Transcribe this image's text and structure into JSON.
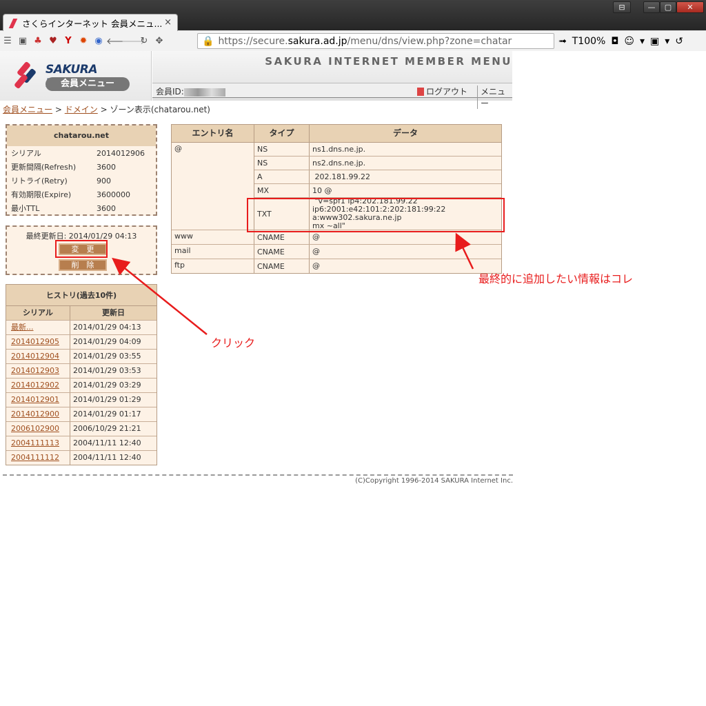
{
  "browser": {
    "tab_title": "さくらインターネット 会員メニュ...",
    "tab_close": "×",
    "url_scheme": "https://secure.",
    "url_host": "sakura.ad.jp",
    "url_path": "/menu/dns/view.php?zone=chatar",
    "zoom": "T100%",
    "window_buttons": [
      "⊟",
      "—",
      "▢",
      "✕"
    ]
  },
  "header": {
    "brand": "SAKURA Internet",
    "brand_sub": "会員メニュー",
    "title": "SAKURA INTERNET MEMBER MENU",
    "member_id_label": "会員ID:",
    "logout": "ログアウト",
    "menu": "メニュー"
  },
  "breadcrumb": {
    "item1": "会員メニュー",
    "sep": ">",
    "item2": "ドメイン",
    "current": "ゾーン表示(chatarou.net)"
  },
  "zone": {
    "name": "chatarou.net",
    "rows": [
      {
        "label": "シリアル",
        "value": "2014012906"
      },
      {
        "label": "更新間隔(Refresh)",
        "value": "3600"
      },
      {
        "label": "リトライ(Retry)",
        "value": "900"
      },
      {
        "label": "有効期限(Expire)",
        "value": "3600000"
      },
      {
        "label": "最小TTL",
        "value": "3600"
      }
    ]
  },
  "actions": {
    "last_updated": "最終更新日: 2014/01/29 04:13",
    "change_button": "変　更",
    "delete_button": "削　除"
  },
  "history": {
    "title": "ヒストリ(過去10件)",
    "col_serial": "シリアル",
    "col_date": "更新日",
    "rows": [
      {
        "serial": "最新...",
        "date": "2014/01/29 04:13"
      },
      {
        "serial": "2014012905",
        "date": "2014/01/29 04:09"
      },
      {
        "serial": "2014012904",
        "date": "2014/01/29 03:55"
      },
      {
        "serial": "2014012903",
        "date": "2014/01/29 03:53"
      },
      {
        "serial": "2014012902",
        "date": "2014/01/29 03:29"
      },
      {
        "serial": "2014012901",
        "date": "2014/01/29 01:29"
      },
      {
        "serial": "2014012900",
        "date": "2014/01/29 01:17"
      },
      {
        "serial": "2006102900",
        "date": "2006/10/29 21:21"
      },
      {
        "serial": "2004111113",
        "date": "2004/11/11 12:40"
      },
      {
        "serial": "2004111112",
        "date": "2004/11/11 12:40"
      }
    ]
  },
  "dns": {
    "col_entry": "エントリ名",
    "col_type": "タイプ",
    "col_data": "データ",
    "groups": [
      {
        "entry": "@",
        "records": [
          {
            "type": "NS",
            "data": "ns1.dns.ne.jp."
          },
          {
            "type": "NS",
            "data": "ns2.dns.ne.jp."
          },
          {
            "type": "A",
            "data": " 202.181.99.22"
          },
          {
            "type": "MX",
            "data": "10 @"
          },
          {
            "type": "TXT",
            "data": " \"v=spf1 ip4:202.181.99.22\nip6:2001:e42:101:2:202:181:99:22 a:www302.sakura.ne.jp\nmx ~all\""
          }
        ]
      },
      {
        "entry": "www",
        "records": [
          {
            "type": "CNAME",
            "data": "@"
          }
        ]
      },
      {
        "entry": "mail",
        "records": [
          {
            "type": "CNAME",
            "data": "@"
          }
        ]
      },
      {
        "entry": "ftp",
        "records": [
          {
            "type": "CNAME",
            "data": "@"
          }
        ]
      }
    ]
  },
  "footer": {
    "copyright": "(C)Copyright 1996-2014 SAKURA Internet Inc."
  },
  "annotations": {
    "click_label": "クリック",
    "txt_label": "最終的に追加したい情報はコレ",
    "color": "#e81c1c"
  }
}
